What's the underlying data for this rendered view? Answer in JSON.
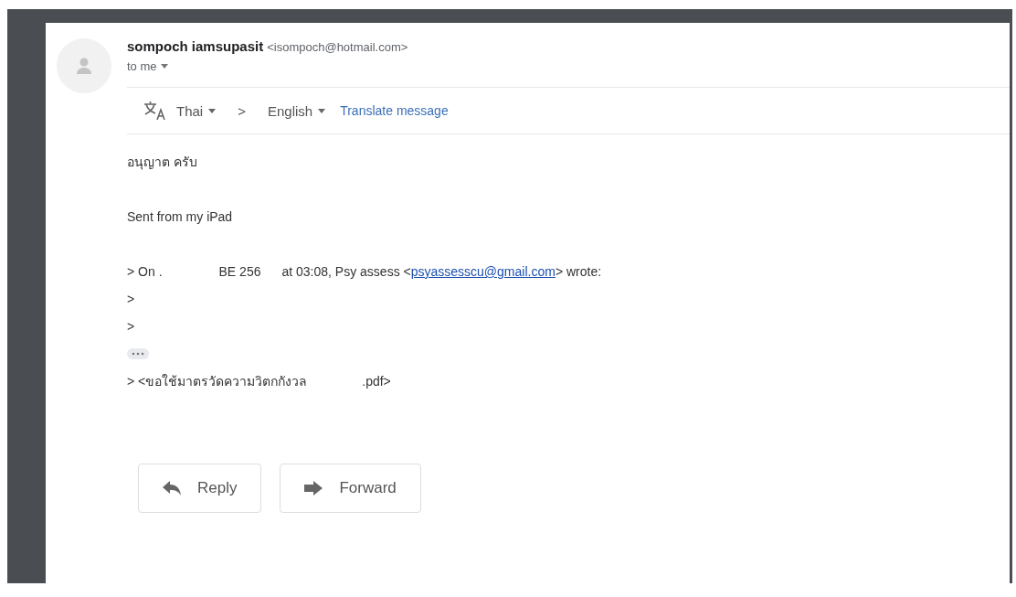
{
  "sender": {
    "name": "sompoch iamsupasit",
    "email": "<isompoch@hotmail.com>",
    "recipient": "to me"
  },
  "translate_bar": {
    "from": "Thai",
    "arrow": ">",
    "to": "English",
    "action": "Translate message"
  },
  "body": {
    "lines": [
      "อนุญาต ครับ",
      "Sent from my iPad"
    ],
    "quote": {
      "prefix": "> On .",
      "date": "BE 256",
      "rest": "at 03:08, Psy assess <",
      "link": "psyassesscu@gmail.com",
      "end": "> wrote:"
    },
    "quote_marks": [
      ">",
      ">"
    ],
    "attachment": {
      "start": "> <ขอใช้มาตรวัดความวิตกกังวล",
      "end": ".pdf>"
    }
  },
  "actions": [
    {
      "kind": "reply",
      "label": "Reply"
    },
    {
      "kind": "forward",
      "label": "Forward"
    }
  ]
}
